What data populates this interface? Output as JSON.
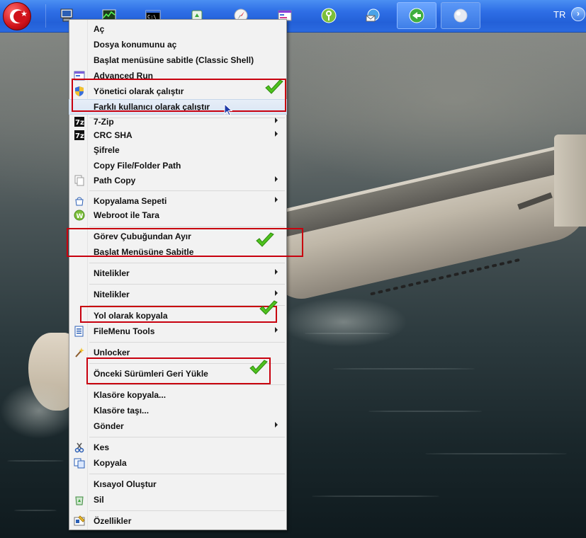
{
  "taskbar": {
    "language": "TR",
    "tray_expand_icon": "chevron-right-icon",
    "buttons": [
      {
        "name": "computer-icon"
      },
      {
        "name": "system-monitor-icon"
      },
      {
        "name": "command-prompt-icon"
      },
      {
        "name": "recycle-icon"
      },
      {
        "name": "safari-compass-icon"
      },
      {
        "name": "control-panel-icon"
      },
      {
        "name": "key-icon"
      },
      {
        "name": "mail-globe-icon"
      },
      {
        "name": "active-app-icon"
      },
      {
        "name": "orb-icon"
      }
    ]
  },
  "menu": {
    "items": [
      {
        "label": "Aç"
      },
      {
        "label": "Dosya konumunu aç"
      },
      {
        "label": "Başlat menüsüne sabitle (Classic Shell)"
      },
      {
        "label": "Advanced Run",
        "icon": "advanced-run-icon"
      },
      {
        "label": "Yönetici olarak çalıştır",
        "icon": "uac-shield-icon"
      },
      {
        "label": "Farklı kullanıcı olarak çalıştır"
      },
      {
        "label": "7-Zip",
        "icon": "7zip-icon"
      },
      {
        "label": "CRC SHA",
        "icon": "7zip-icon"
      },
      {
        "label": "Şifrele"
      },
      {
        "label": "Copy File/Folder Path"
      },
      {
        "label": "Path Copy",
        "icon": "path-copy-icon"
      },
      {
        "label": "Kopyalama Sepeti",
        "icon": "basket-icon"
      },
      {
        "label": "Webroot ile Tara",
        "icon": "webroot-icon"
      },
      {
        "label": "Görev Çubuğundan Ayır"
      },
      {
        "label": "Başlat Menüsüne Sabitle"
      },
      {
        "label": "Nitelikler"
      },
      {
        "label": "Nitelikler"
      },
      {
        "label": "Yol olarak kopyala"
      },
      {
        "label": "FileMenu Tools",
        "icon": "filemenu-tools-icon"
      },
      {
        "label": "Unlocker",
        "icon": "wand-icon"
      },
      {
        "label": "Önceki Sürümleri Geri Yükle"
      },
      {
        "label": "Klasöre kopyala..."
      },
      {
        "label": "Klasöre taşı..."
      },
      {
        "label": "Gönder"
      },
      {
        "label": "Kes",
        "icon": "scissors-icon"
      },
      {
        "label": "Kopyala",
        "icon": "copy-icon"
      },
      {
        "label": "Kısayol Oluştur"
      },
      {
        "label": "Sil",
        "icon": "recycle-bin-icon"
      },
      {
        "label": "Özellikler",
        "icon": "properties-icon"
      }
    ]
  },
  "colors": {
    "annotation_red": "#c8000e",
    "check_green": "#4fc21e",
    "highlight": "#dbe5f3",
    "taskbar_blue": "#2f6fe6"
  }
}
